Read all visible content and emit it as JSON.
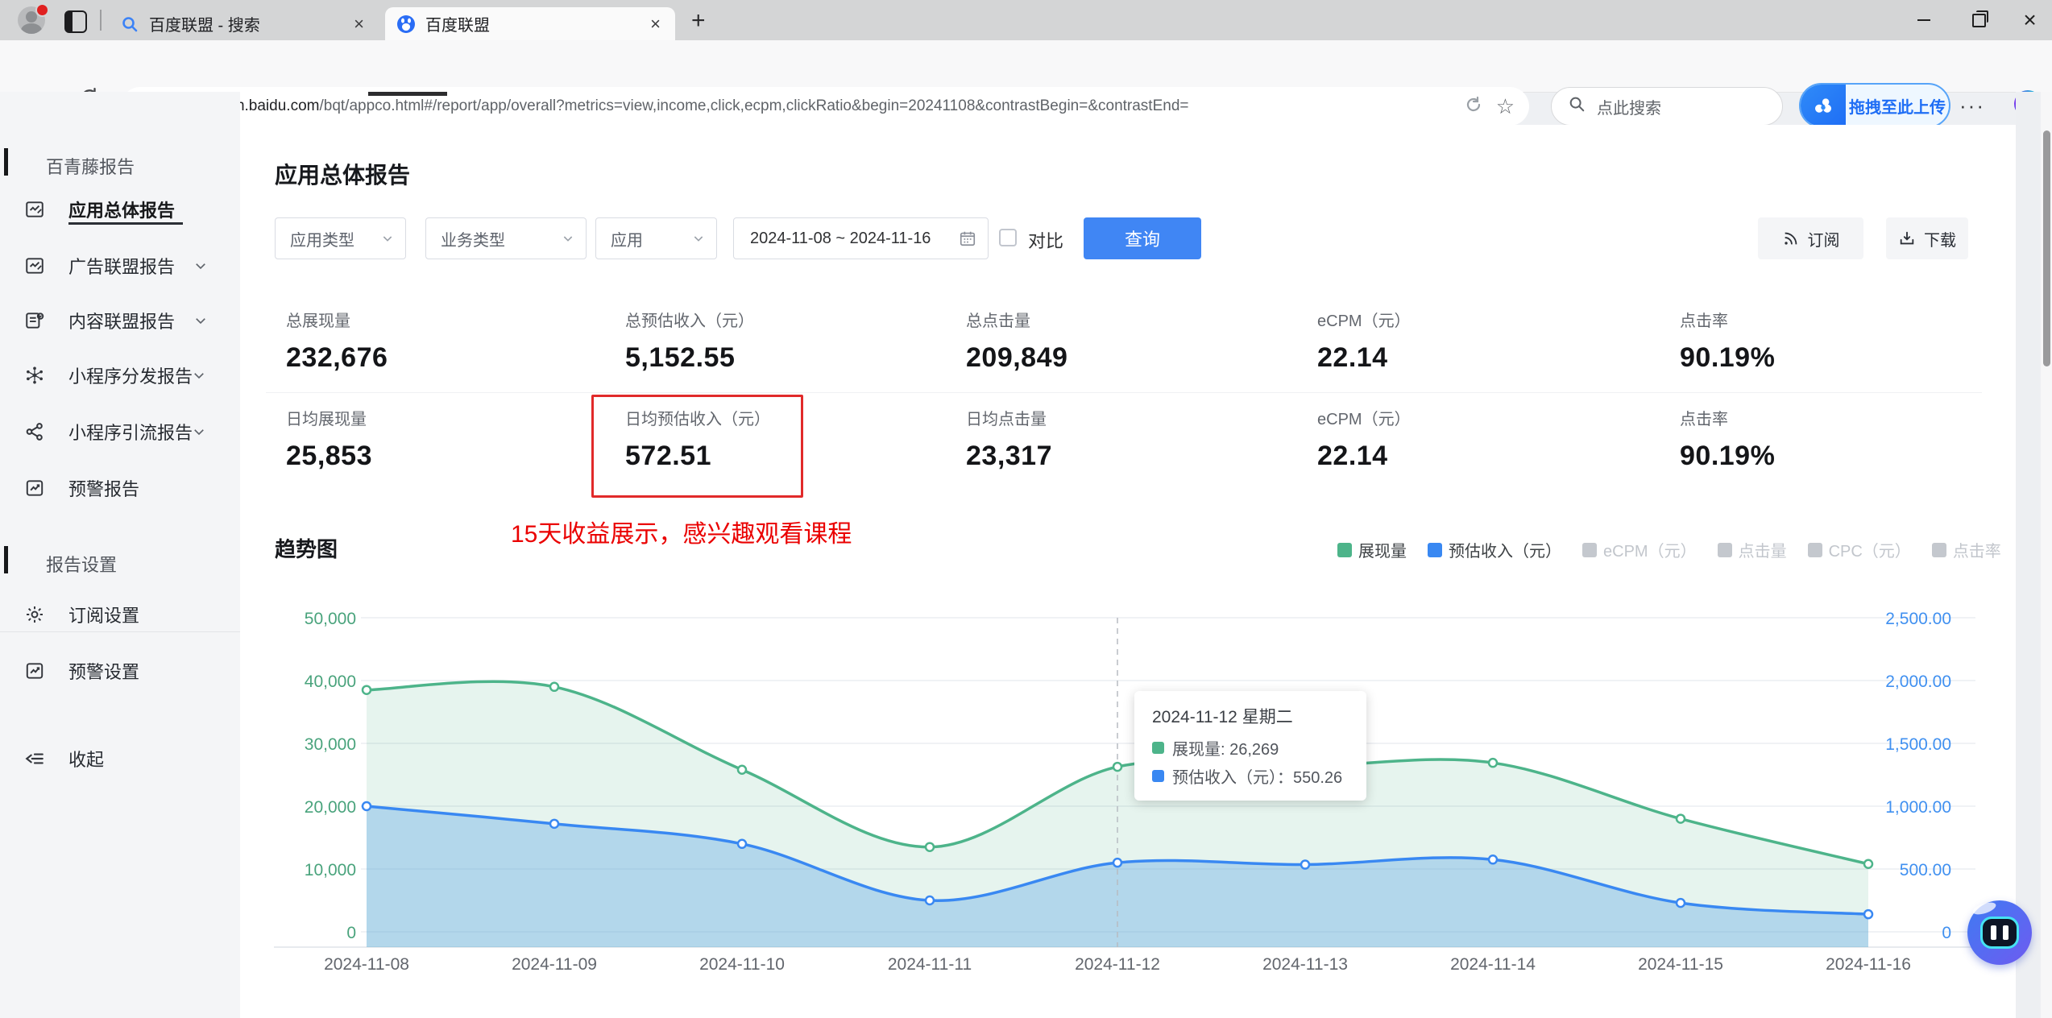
{
  "colors": {
    "accent": "#4086f4",
    "green": "#4db48a",
    "blue": "#3988f2",
    "red_annotation": "#ea0000",
    "red_box": "#e12a2a"
  },
  "browser": {
    "tabs": [
      {
        "id": "search",
        "label": "百度联盟 - 搜索",
        "favicon": "search-favicon"
      },
      {
        "id": "union",
        "label": "百度联盟",
        "favicon": "baidu-paw-favicon",
        "active": true
      }
    ],
    "toolbar": {
      "url": {
        "scheme": "https://",
        "host": "union.baidu.com",
        "path": "/bqt/appco.html#/report/app/overall?metrics=view,income,click,ecpm,clickRatio&begin=20241108&contrastBegin=&contrastEnd="
      },
      "search_placeholder": "点此搜索",
      "upload_button_label": "拖拽至此上传"
    }
  },
  "sidebar": {
    "section1_title": "百青藤报告",
    "items": [
      {
        "id": "overall-report",
        "label": "应用总体报告",
        "icon": "report-icon",
        "active": true
      },
      {
        "id": "ad-union-report",
        "label": "广告联盟报告",
        "icon": "report-icon",
        "chevron": true
      },
      {
        "id": "content-union-report",
        "label": "内容联盟报告",
        "icon": "content-report-icon",
        "chevron": true
      },
      {
        "id": "mini-program-distribute-report",
        "label": "小程序分发报告",
        "icon": "distribute-icon",
        "chevron": true
      },
      {
        "id": "mini-program-traffic-report",
        "label": "小程序引流报告",
        "icon": "share-icon",
        "chevron": true
      },
      {
        "id": "alert-report",
        "label": "预警报告",
        "icon": "alert-icon"
      }
    ],
    "section2_title": "报告设置",
    "settings_items": [
      {
        "id": "subscribe-settings",
        "label": "订阅设置",
        "icon": "gear-icon"
      },
      {
        "id": "alert-settings",
        "label": "预警设置",
        "icon": "alert-icon"
      }
    ],
    "collapse_label": "收起"
  },
  "main": {
    "page_title": "应用总体报告",
    "filters": {
      "dropdowns": [
        "应用类型",
        "业务类型",
        "应用"
      ],
      "date_range": "2024-11-08 ~ 2024-11-16",
      "compare_label": "对比",
      "query_label": "查询",
      "subscribe_label": "订阅",
      "download_label": "下载"
    },
    "stats_rows": [
      [
        {
          "label": "总展现量",
          "value": "232,676"
        },
        {
          "label": "总预估收入（元）",
          "value": "5,152.55"
        },
        {
          "label": "总点击量",
          "value": "209,849"
        },
        {
          "label": "eCPM（元）",
          "value": "22.14"
        },
        {
          "label": "点击率",
          "value": "90.19%"
        }
      ],
      [
        {
          "label": "日均展现量",
          "value": "25,853"
        },
        {
          "label": "日均预估收入（元）",
          "value": "572.51",
          "highlighted": true
        },
        {
          "label": "日均点击量",
          "value": "23,317"
        },
        {
          "label": "eCPM（元）",
          "value": "22.14"
        },
        {
          "label": "点击率",
          "value": "90.19%"
        }
      ]
    ],
    "annotation": "15天收益展示，感兴趣观看课程",
    "trend_title": "趋势图"
  },
  "chart_data": {
    "type": "area",
    "x": [
      "2024-11-08",
      "2024-11-09",
      "2024-11-10",
      "2024-11-11",
      "2024-11-12",
      "2024-11-13",
      "2024-11-14",
      "2024-11-15",
      "2024-11-16"
    ],
    "series": [
      {
        "name": "展现量",
        "axis": "left",
        "color": "#4db48a",
        "fill": "rgba(77,180,138,0.14)",
        "values": [
          38500,
          39000,
          25800,
          13500,
          26269,
          26400,
          26900,
          18000,
          10800
        ]
      },
      {
        "name": "预估收入（元）",
        "axis": "right",
        "color": "#3988f2",
        "fill": "rgba(96,168,232,0.38)",
        "values": [
          1000,
          860,
          700,
          250,
          550.26,
          535,
          575,
          230,
          140
        ]
      }
    ],
    "left_axis": {
      "color": "#49a37c",
      "max": 50000,
      "ticks_top_down": [
        "50,000",
        "40,000",
        "30,000",
        "20,000",
        "10,000",
        "0"
      ]
    },
    "right_axis": {
      "color": "#4090f0",
      "max": 2500,
      "ticks_top_down": [
        "2,500.00",
        "2,000.00",
        "1,500.00",
        "1,000.00",
        "500.00",
        "0"
      ]
    },
    "grid": true,
    "legend": [
      {
        "label": "展现量",
        "color": "#4db48a",
        "active": true
      },
      {
        "label": "预估收入（元）",
        "color": "#3988f2",
        "active": true
      },
      {
        "label": "eCPM（元）",
        "color": "#c4c8ce",
        "active": false
      },
      {
        "label": "点击量",
        "color": "#c4c8ce",
        "active": false
      },
      {
        "label": "CPC（元）",
        "color": "#c4c8ce",
        "active": false
      },
      {
        "label": "点击率",
        "color": "#c4c8ce",
        "active": false
      }
    ],
    "hover_index": 4,
    "tooltip": {
      "title": "2024-11-12 星期二",
      "rows": [
        {
          "color": "#4db48a",
          "text": "展现量: 26,269"
        },
        {
          "color": "#3988f2",
          "text": "预估收入（元）：550.26"
        }
      ]
    }
  }
}
